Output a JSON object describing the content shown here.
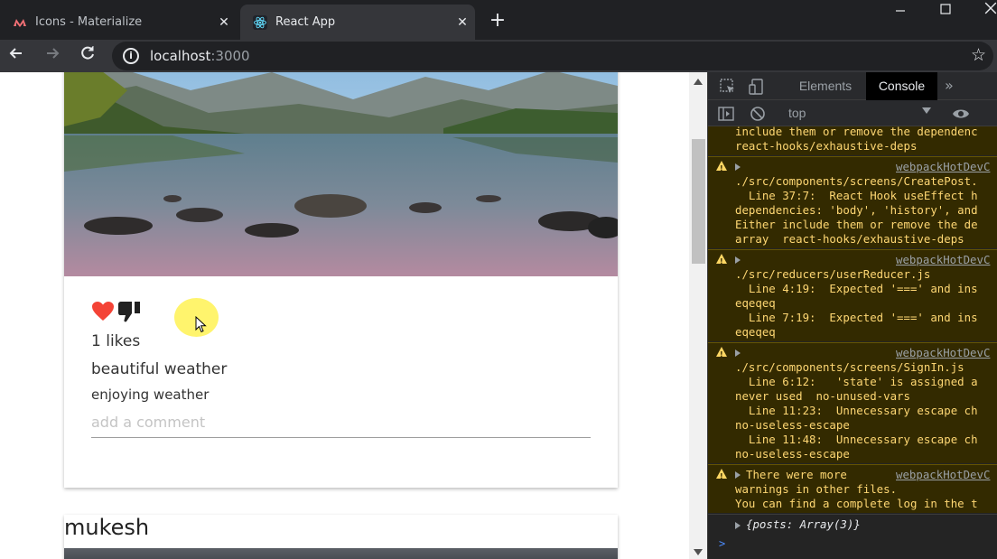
{
  "browser": {
    "tabs": [
      {
        "title": "Icons - Materialize",
        "active": false,
        "favicon": "materialize-logo-icon"
      },
      {
        "title": "React App",
        "active": true,
        "favicon": "react-logo-icon"
      }
    ],
    "new_tab_label": "+",
    "url_host": "localhost",
    "url_port": ":3000",
    "window_controls": [
      "minimize-icon",
      "maximize-icon",
      "close-icon"
    ]
  },
  "page": {
    "posts": [
      {
        "likes_text": "1 likes",
        "title": "beautiful weather",
        "body": "enjoying weather",
        "comment_placeholder": "add a comment"
      },
      {
        "author": "mukesh"
      }
    ],
    "colors": {
      "like": "#f44336",
      "dislike": "#212121"
    }
  },
  "devtools": {
    "tabs": [
      "Elements",
      "Console"
    ],
    "active_tab": "Console",
    "context": "top",
    "messages": [
      {
        "type": "warning",
        "source": "",
        "lines": [
          "include them or remove the dependenc",
          "react-hooks/exhaustive-deps"
        ]
      },
      {
        "type": "warning",
        "source": "webpackHotDevC",
        "lines": [
          "./src/components/screens/CreatePost.",
          "  Line 37:7:  React Hook useEffect h",
          "dependencies: 'body', 'history', and",
          "Either include them or remove the de",
          "array  react-hooks/exhaustive-deps"
        ]
      },
      {
        "type": "warning",
        "source": "webpackHotDevC",
        "lines": [
          "./src/reducers/userReducer.js",
          "  Line 4:19:  Expected '===' and ins",
          "eqeqeq",
          "  Line 7:19:  Expected '===' and ins",
          "eqeqeq"
        ]
      },
      {
        "type": "warning",
        "source": "webpackHotDevC",
        "lines": [
          "./src/components/screens/SignIn.js",
          "  Line 6:12:   'state' is assigned a",
          "never used  no-unused-vars",
          "  Line 11:23:  Unnecessary escape ch",
          "no-useless-escape",
          "  Line 11:48:  Unnecessary escape ch",
          "no-useless-escape"
        ]
      },
      {
        "type": "warning",
        "source": "webpackHotDevC",
        "lines": [
          "There were more",
          "warnings in other files.",
          "You can find a complete log in the t"
        ]
      }
    ],
    "log_object": "{posts: Array(3)}",
    "prompt": ">"
  }
}
